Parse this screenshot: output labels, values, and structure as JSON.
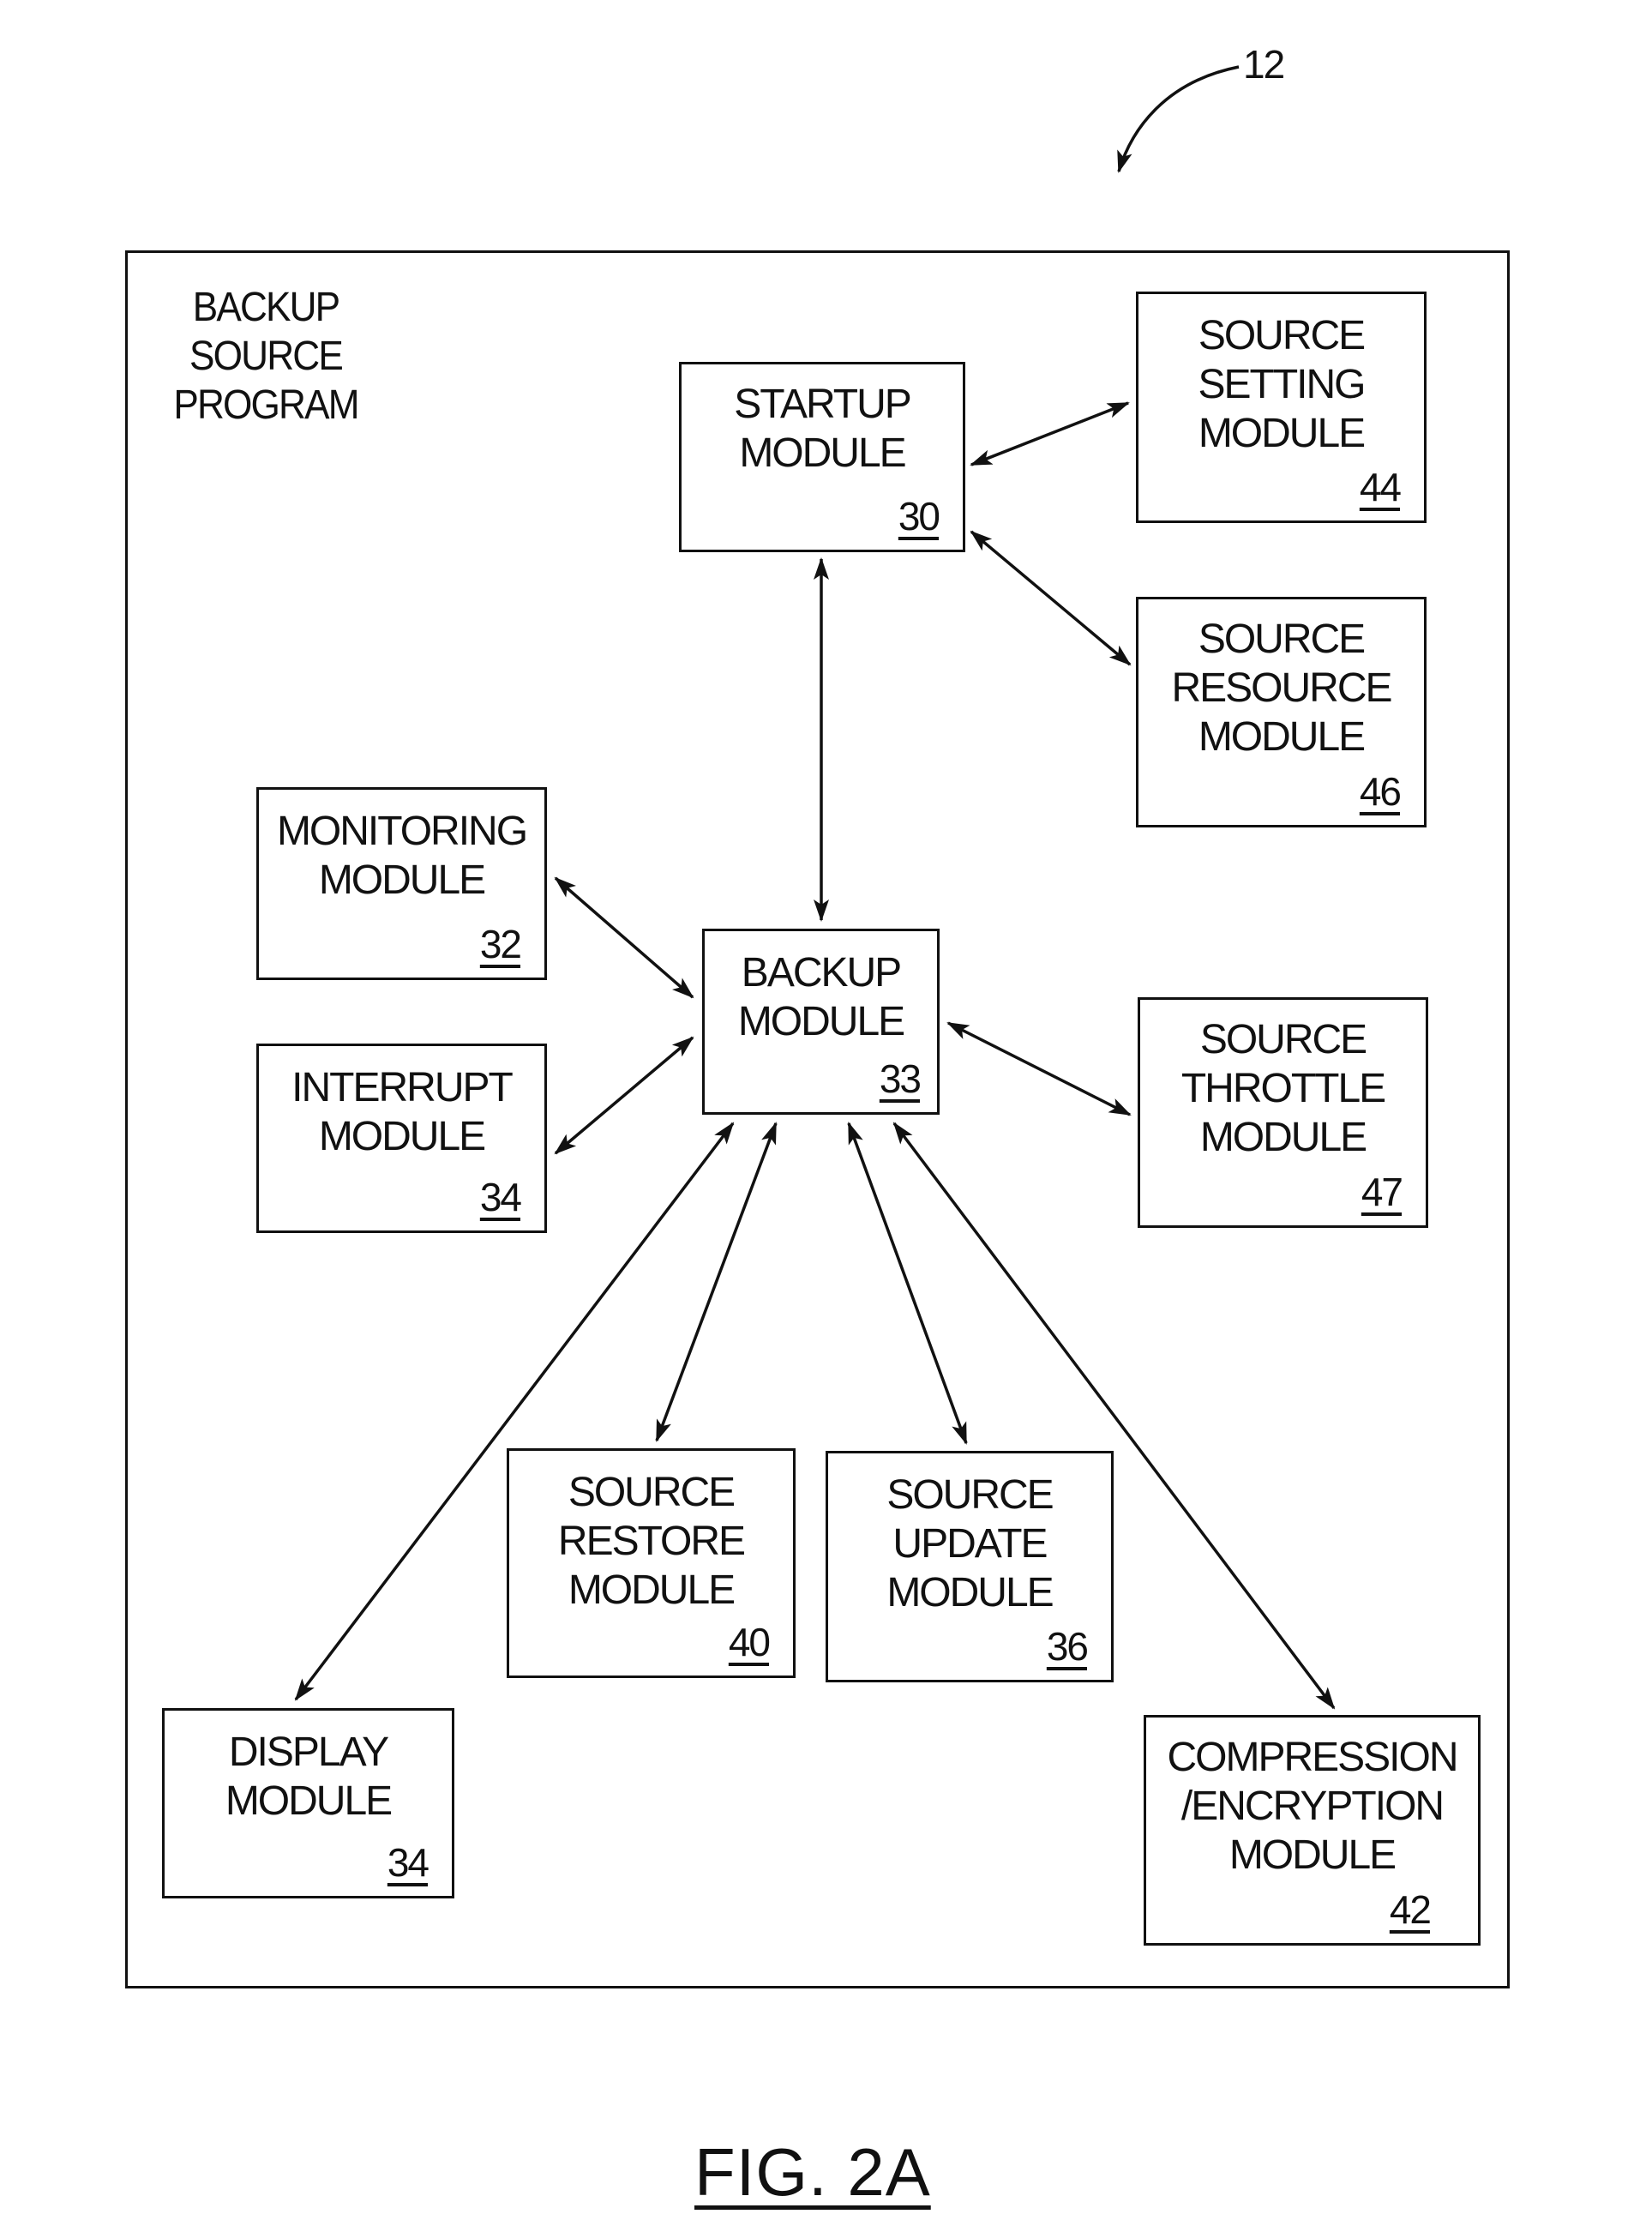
{
  "figure": {
    "reference_numeral": "12",
    "caption": "FIG. 2A",
    "program_label": "BACKUP\nSOURCE\nPROGRAM"
  },
  "modules": {
    "startup": {
      "name": "STARTUP\nMODULE",
      "ref": "30"
    },
    "source_setting": {
      "name": "SOURCE\nSETTING\nMODULE",
      "ref": "44"
    },
    "source_resource": {
      "name": "SOURCE\nRESOURCE\nMODULE",
      "ref": "46"
    },
    "monitoring": {
      "name": "MONITORING\nMODULE",
      "ref": "32"
    },
    "backup": {
      "name": "BACKUP\nMODULE",
      "ref": "33"
    },
    "interrupt": {
      "name": "INTERRUPT\nMODULE",
      "ref": "34"
    },
    "source_throttle": {
      "name": "SOURCE\nTHROTTLE\nMODULE",
      "ref": "47"
    },
    "source_restore": {
      "name": "SOURCE\nRESTORE\nMODULE",
      "ref": "40"
    },
    "source_update": {
      "name": "SOURCE\nUPDATE\nMODULE",
      "ref": "36"
    },
    "display": {
      "name": "DISPLAY\nMODULE",
      "ref": "34"
    },
    "compression_encryption": {
      "name": "COMPRESSION\n/ENCRYPTION\nMODULE",
      "ref": "42"
    }
  },
  "connections": [
    {
      "from": "startup",
      "to": "source_setting",
      "type": "bidirectional"
    },
    {
      "from": "startup",
      "to": "source_resource",
      "type": "bidirectional"
    },
    {
      "from": "startup",
      "to": "backup",
      "type": "bidirectional"
    },
    {
      "from": "backup",
      "to": "monitoring",
      "type": "bidirectional"
    },
    {
      "from": "backup",
      "to": "interrupt",
      "type": "bidirectional"
    },
    {
      "from": "backup",
      "to": "source_throttle",
      "type": "bidirectional"
    },
    {
      "from": "backup",
      "to": "display",
      "type": "bidirectional"
    },
    {
      "from": "backup",
      "to": "source_restore",
      "type": "bidirectional"
    },
    {
      "from": "backup",
      "to": "source_update",
      "type": "bidirectional"
    },
    {
      "from": "backup",
      "to": "compression_encryption",
      "type": "bidirectional"
    }
  ]
}
